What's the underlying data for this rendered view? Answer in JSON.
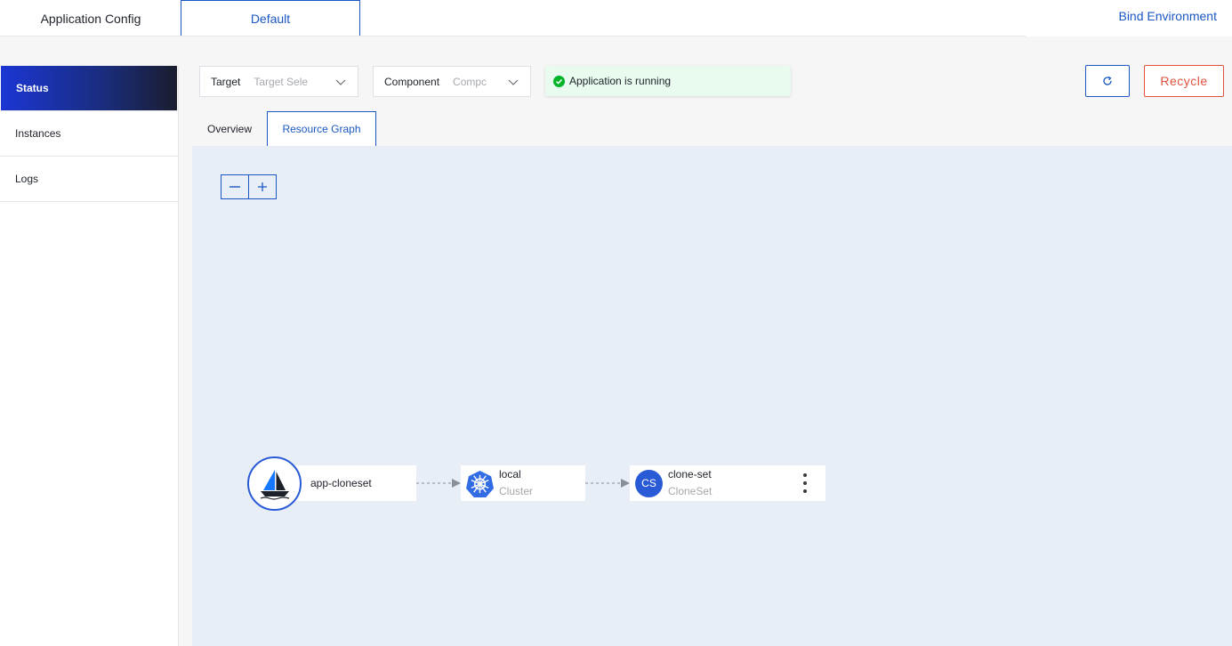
{
  "top_tabs": {
    "app_config": "Application Config",
    "default": "Default"
  },
  "bind_environment": "Bind Environment",
  "sidebar": {
    "items": [
      {
        "label": "Status",
        "active": true
      },
      {
        "label": "Instances",
        "active": false
      },
      {
        "label": "Logs",
        "active": false
      }
    ]
  },
  "filters": {
    "target": {
      "label": "Target",
      "placeholder": "Target Sele"
    },
    "component": {
      "label": "Component",
      "placeholder": "Compc"
    }
  },
  "status_message": "Application is running",
  "actions": {
    "refresh_icon": "refresh-icon",
    "recycle_label": "Recycle"
  },
  "content_tabs": {
    "overview": "Overview",
    "resource_graph": "Resource Graph"
  },
  "graph": {
    "app_node": {
      "name": "app-cloneset",
      "icon": "sailboat-icon"
    },
    "cluster_node": {
      "name": "local",
      "type": "Cluster",
      "icon": "kubernetes-icon"
    },
    "resource_node": {
      "name": "clone-set",
      "type": "CloneSet",
      "badge": "CS"
    }
  },
  "colors": {
    "primary": "#1b58c4",
    "danger": "#e0533f",
    "success": "#00b42a",
    "success_bg": "#e9fbef",
    "canvas_bg": "#e8eef6",
    "sidebar_active_start": "#1b36d4",
    "sidebar_active_end": "#1a1d2e"
  }
}
